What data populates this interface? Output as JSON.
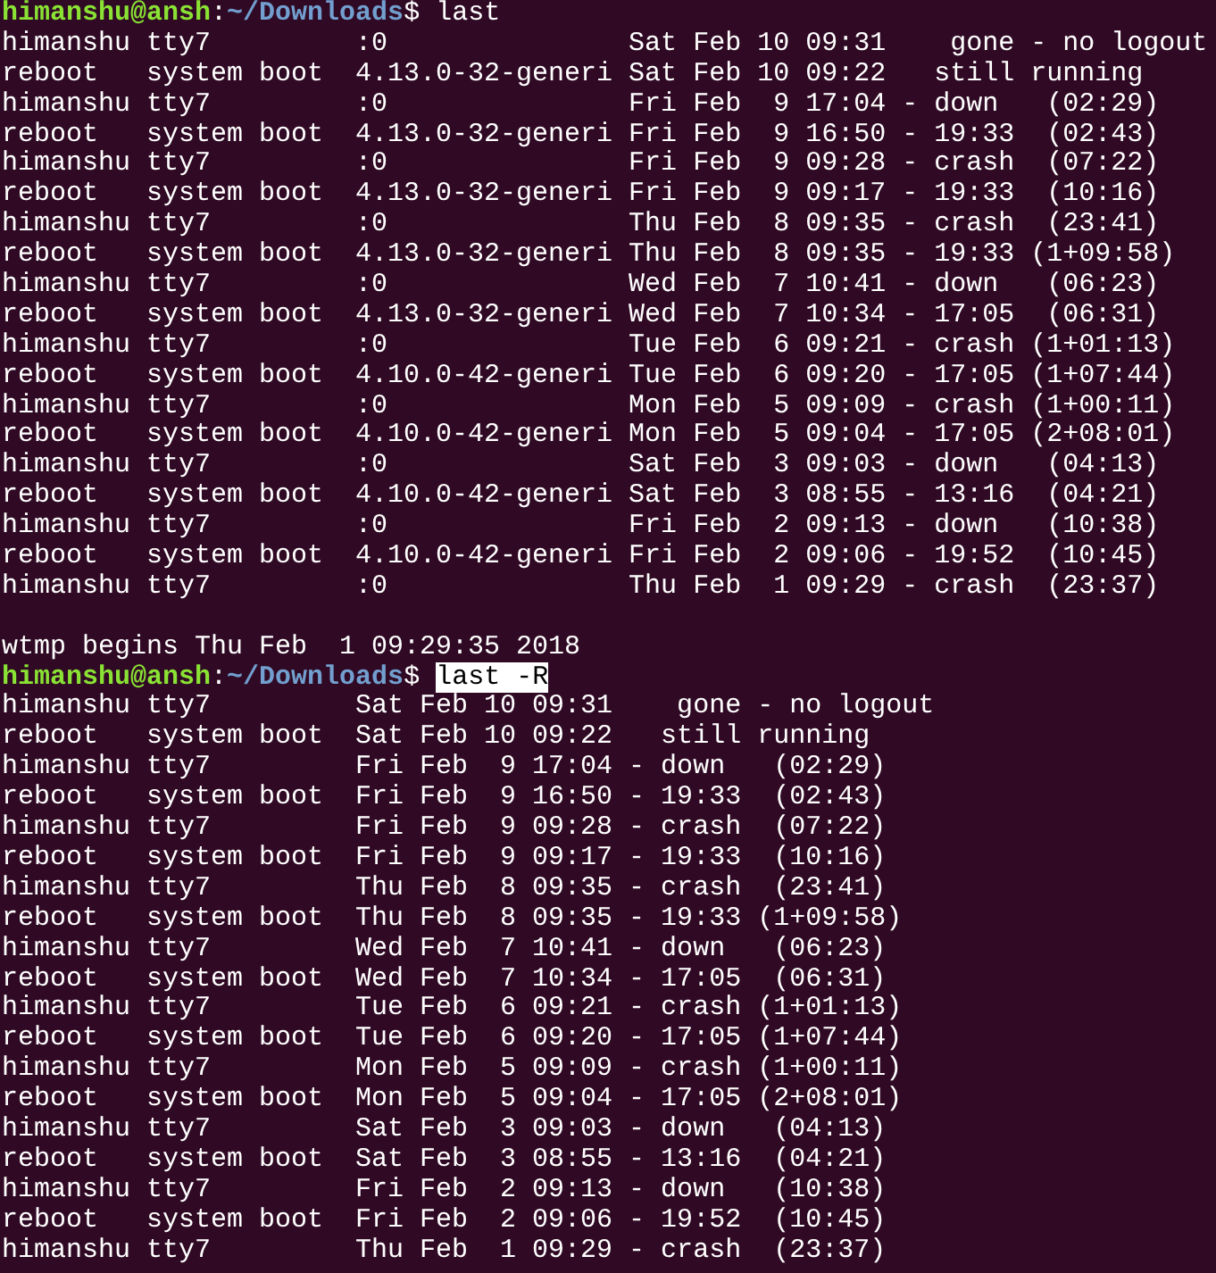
{
  "terminal": {
    "blocks": [
      {
        "prompt": {
          "user_host": "himanshu@ansh",
          "separator": ":",
          "path": "~/Downloads",
          "symbol": "$",
          "command": "last",
          "selected": false
        },
        "output": [
          "himanshu tty7         :0               Sat Feb 10 09:31    gone - no logout",
          "reboot   system boot  4.13.0-32-generi Sat Feb 10 09:22   still running",
          "himanshu tty7         :0               Fri Feb  9 17:04 - down   (02:29)",
          "reboot   system boot  4.13.0-32-generi Fri Feb  9 16:50 - 19:33  (02:43)",
          "himanshu tty7         :0               Fri Feb  9 09:28 - crash  (07:22)",
          "reboot   system boot  4.13.0-32-generi Fri Feb  9 09:17 - 19:33  (10:16)",
          "himanshu tty7         :0               Thu Feb  8 09:35 - crash  (23:41)",
          "reboot   system boot  4.13.0-32-generi Thu Feb  8 09:35 - 19:33 (1+09:58)",
          "himanshu tty7         :0               Wed Feb  7 10:41 - down   (06:23)",
          "reboot   system boot  4.13.0-32-generi Wed Feb  7 10:34 - 17:05  (06:31)",
          "himanshu tty7         :0               Tue Feb  6 09:21 - crash (1+01:13)",
          "reboot   system boot  4.10.0-42-generi Tue Feb  6 09:20 - 17:05 (1+07:44)",
          "himanshu tty7         :0               Mon Feb  5 09:09 - crash (1+00:11)",
          "reboot   system boot  4.10.0-42-generi Mon Feb  5 09:04 - 17:05 (2+08:01)",
          "himanshu tty7         :0               Sat Feb  3 09:03 - down   (04:13)",
          "reboot   system boot  4.10.0-42-generi Sat Feb  3 08:55 - 13:16  (04:21)",
          "himanshu tty7         :0               Fri Feb  2 09:13 - down   (10:38)",
          "reboot   system boot  4.10.0-42-generi Fri Feb  2 09:06 - 19:52  (10:45)",
          "himanshu tty7         :0               Thu Feb  1 09:29 - crash  (23:37)"
        ],
        "footer": "wtmp begins Thu Feb  1 09:29:35 2018"
      },
      {
        "prompt": {
          "user_host": "himanshu@ansh",
          "separator": ":",
          "path": "~/Downloads",
          "symbol": "$",
          "command": "last -R",
          "selected": true
        },
        "output": [
          "himanshu tty7         Sat Feb 10 09:31    gone - no logout",
          "reboot   system boot  Sat Feb 10 09:22   still running",
          "himanshu tty7         Fri Feb  9 17:04 - down   (02:29)",
          "reboot   system boot  Fri Feb  9 16:50 - 19:33  (02:43)",
          "himanshu tty7         Fri Feb  9 09:28 - crash  (07:22)",
          "reboot   system boot  Fri Feb  9 09:17 - 19:33  (10:16)",
          "himanshu tty7         Thu Feb  8 09:35 - crash  (23:41)",
          "reboot   system boot  Thu Feb  8 09:35 - 19:33 (1+09:58)",
          "himanshu tty7         Wed Feb  7 10:41 - down   (06:23)",
          "reboot   system boot  Wed Feb  7 10:34 - 17:05  (06:31)",
          "himanshu tty7         Tue Feb  6 09:21 - crash (1+01:13)",
          "reboot   system boot  Tue Feb  6 09:20 - 17:05 (1+07:44)",
          "himanshu tty7         Mon Feb  5 09:09 - crash (1+00:11)",
          "reboot   system boot  Mon Feb  5 09:04 - 17:05 (2+08:01)",
          "himanshu tty7         Sat Feb  3 09:03 - down   (04:13)",
          "reboot   system boot  Sat Feb  3 08:55 - 13:16  (04:21)",
          "himanshu tty7         Fri Feb  2 09:13 - down   (10:38)",
          "reboot   system boot  Fri Feb  2 09:06 - 19:52  (10:45)",
          "himanshu tty7         Thu Feb  1 09:29 - crash  (23:37)"
        ]
      }
    ]
  }
}
